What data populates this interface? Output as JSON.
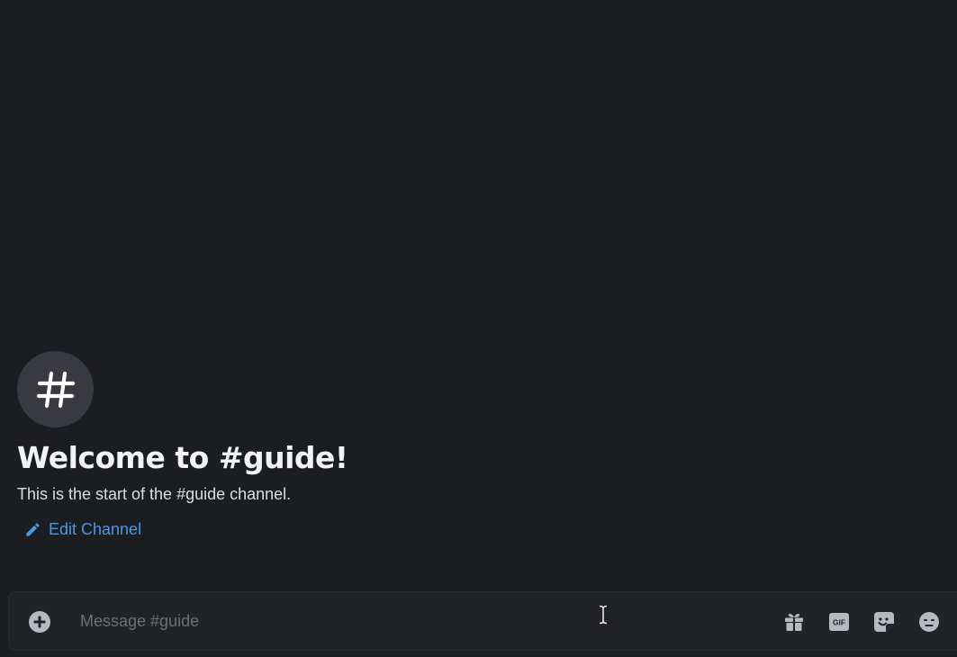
{
  "channel": {
    "avatar_glyph": "#",
    "welcome_title": "Welcome to #guide!",
    "welcome_subtitle": "This is the start of the #guide channel.",
    "edit_label": "Edit Channel"
  },
  "composer": {
    "placeholder": "Message #guide",
    "value": "",
    "tools": {
      "add": "plus-circle-icon",
      "gift": "gift-icon",
      "gif": "GIF",
      "sticker": "sticker-icon",
      "emoji": "emoji-icon"
    }
  },
  "colors": {
    "background": "#1c1d21",
    "composer_background": "#222327",
    "avatar_background": "#393a41",
    "link": "#4b97e6",
    "icon": "#b5bac1"
  }
}
